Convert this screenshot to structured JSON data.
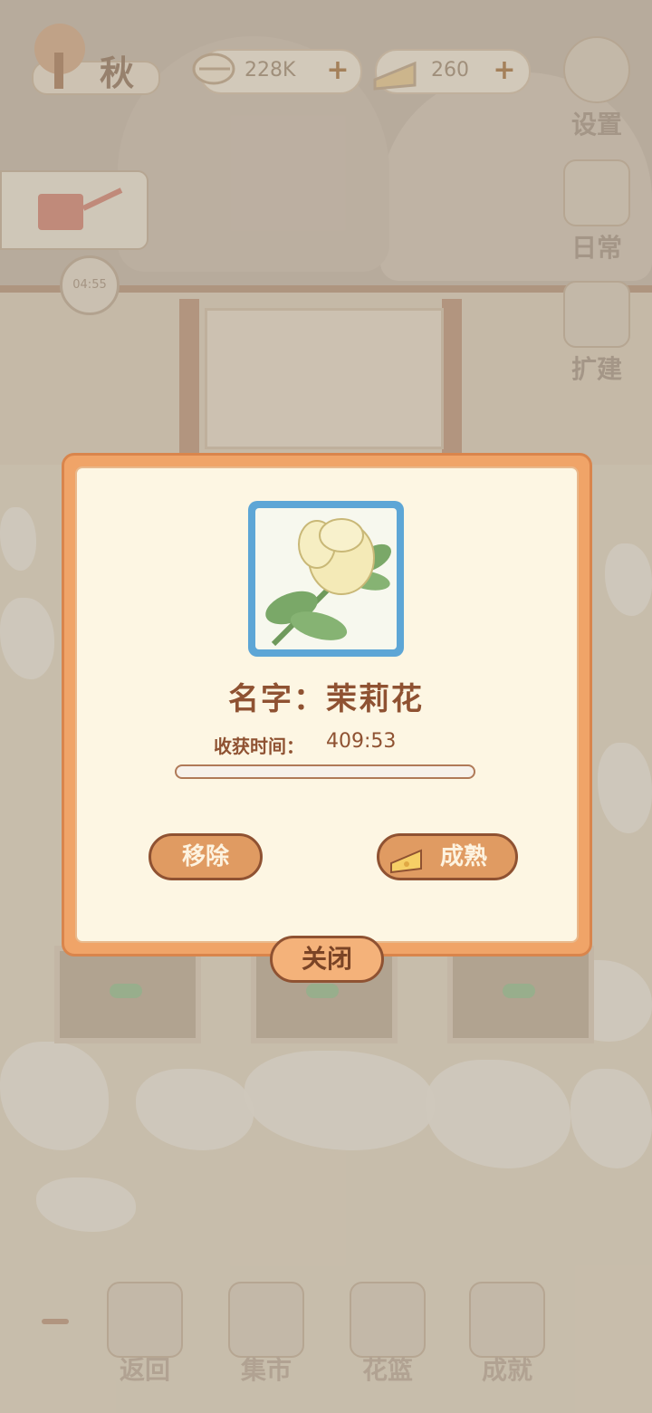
{
  "hud": {
    "season": "秋",
    "fish_amount": "228K",
    "cheese_amount": "260",
    "timer": "04:55"
  },
  "side_menu": {
    "settings": "设置",
    "daily": "日常",
    "expand": "扩建"
  },
  "dialog": {
    "name_text": "名字：茉莉花",
    "harvest_label": "收获时间：",
    "harvest_value": "409:53",
    "progress_fraction": 0.0,
    "remove_label": "移除",
    "mature_label": "成熟",
    "close_label": "关闭"
  },
  "bottom_nav": {
    "back": "返回",
    "market": "集市",
    "basket": "花篮",
    "achievements": "成就"
  }
}
